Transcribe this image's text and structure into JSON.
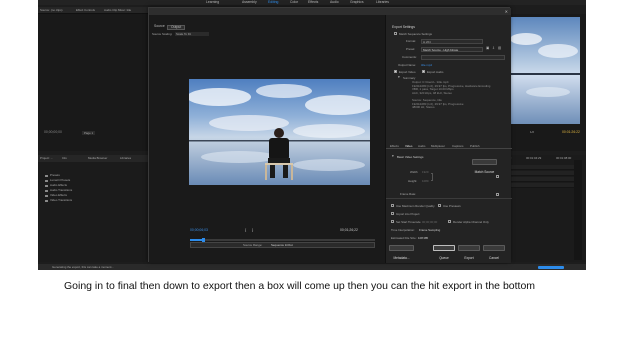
{
  "caption": "Going in to final then down to export then a box will come up then you can the hit export in the bottom",
  "app": {
    "workspaces": [
      "Learning",
      "Assembly",
      "Editing",
      "Color",
      "Effects",
      "Audio",
      "Graphics",
      "Libraries"
    ],
    "active_workspace": "Editing",
    "source_tabs": [
      "Source: (no clips)",
      "Effect Controls",
      "Audio Clip Mixer: title"
    ],
    "project_tabs": [
      "Project: ...",
      "Info",
      "Media Browser",
      "Libraries"
    ],
    "source_timecode": "00;00;00;00",
    "source_page": "Page 1",
    "project_folders": [
      "Presets",
      "Lumetri Presets",
      "Audio Effects",
      "Audio Transitions",
      "Video Effects",
      "Video Transitions"
    ],
    "program_timecode": "00:01:26:22",
    "program_fit": "1/2",
    "timeline_times": [
      "00:01:00:00",
      "00:01:04:29",
      "00:01:08:00"
    ],
    "status_text": "Generating the export, this can take a moment..."
  },
  "dialog": {
    "title": "Export Settings",
    "tabs": [
      "Source",
      "Output"
    ],
    "active_tab": "Output",
    "source_scaling_label": "Source Scaling:",
    "source_scaling_value": "Scale To Fit",
    "current_timecode": "00;00;06;03",
    "duration_timecode": "00;01;26;22",
    "source_range_label": "Source Range:",
    "source_range_value": "Sequence In/Out",
    "export_settings": {
      "heading": "Export Settings",
      "match_sequence": "Match Sequence Settings",
      "format_label": "Format:",
      "format_value": "H.264",
      "preset_label": "Preset:",
      "preset_value": "Match Source - High bitrate",
      "comments_label": "Comments:",
      "output_name_label": "Output Name:",
      "output_name_value": "title.mp4",
      "export_video": "Export Video",
      "export_audio": "Export Audio",
      "summary_label": "Summary",
      "summary_output_lines": [
        "Output: C:\\Users\\...\\title.mp4",
        "1920x1080 (1.0), 29.97 fps, Progressive, Hardware Encoding",
        "VBR, 1 pass, Target 10.00 Mbps",
        "AAC, 320 kbps, 48 kHz, Stereo"
      ],
      "summary_source_lines": [
        "Source: Sequence, title",
        "1920x1080 (1.0), 29.97 fps, Progressive",
        "48000 Hz, Stereo"
      ]
    },
    "settings_tabs": [
      "Effects",
      "Video",
      "Audio",
      "Multiplexer",
      "Captions",
      "Publish"
    ],
    "active_settings_tab": "Video",
    "basic_video": {
      "heading": "Basic Video Settings",
      "match_source_button": "Match Source",
      "width_label": "Width:",
      "width_value": "1920",
      "height_label": "Height:",
      "height_value": "1080",
      "frame_rate_label": "Frame Rate:"
    },
    "options": [
      "Use Maximum Render Quality",
      "Use Previews",
      "Import into Project",
      "Set Start Timecode",
      "Render Alpha Channel Only"
    ],
    "start_timecode_value": "00;00;00;00",
    "time_interpolation_label": "Time Interpolation:",
    "time_interpolation_value": "Frame Sampling",
    "file_size_label": "Estimated File Size:",
    "file_size_value": "108 MB",
    "buttons": {
      "metadata": "Metadata...",
      "queue": "Queue",
      "export": "Export",
      "cancel": "Cancel"
    }
  },
  "colors": {
    "accent": "#2d8ceb",
    "panel": "#232323",
    "background": "#1d1d1d"
  }
}
